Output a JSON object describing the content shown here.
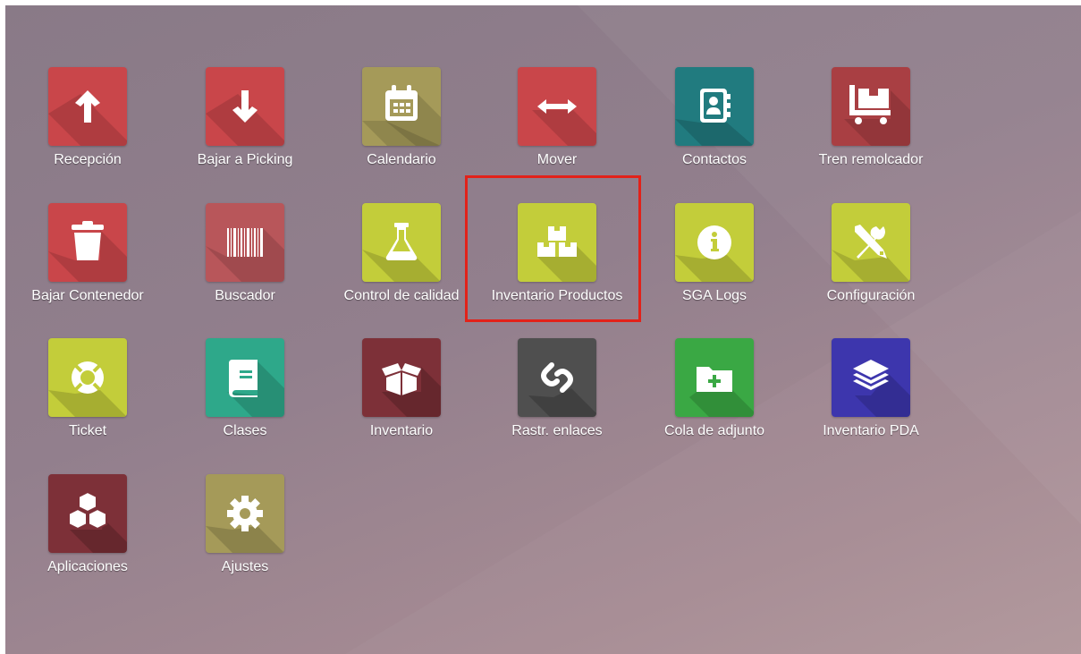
{
  "highlight_color": "#e2221a",
  "apps": [
    {
      "label": "Recepción",
      "icon": "arrow-up-icon",
      "color": "#c9464a"
    },
    {
      "label": "Bajar a Picking",
      "icon": "arrow-down-icon",
      "color": "#c9464a"
    },
    {
      "label": "Calendario",
      "icon": "calendar-icon",
      "color": "#a59a59"
    },
    {
      "label": "Mover",
      "icon": "arrows-horizontal-icon",
      "color": "#c9464a"
    },
    {
      "label": "Contactos",
      "icon": "address-book-icon",
      "color": "#217b7f"
    },
    {
      "label": "Tren remolcador",
      "icon": "dolly-boxes-icon",
      "color": "#a93f43"
    },
    {
      "label": "Bajar Contenedor",
      "icon": "trash-icon",
      "color": "#c9464a"
    },
    {
      "label": "Buscador",
      "icon": "barcode-icon",
      "color": "#b8565a"
    },
    {
      "label": "Control de calidad",
      "icon": "flask-icon",
      "color": "#c3cd3a"
    },
    {
      "label": "Inventario Productos",
      "icon": "cubes-icon",
      "color": "#c3cd3a"
    },
    {
      "label": "SGA Logs",
      "icon": "info-circle-icon",
      "color": "#c3cd3a"
    },
    {
      "label": "Configuración",
      "icon": "wrench-screwdriver-icon",
      "color": "#c3cd3a"
    },
    {
      "label": "Ticket",
      "icon": "life-ring-icon",
      "color": "#c3cd3a"
    },
    {
      "label": "Clases",
      "icon": "book-icon",
      "color": "#2ea88a"
    },
    {
      "label": "Inventario",
      "icon": "open-box-icon",
      "color": "#7d3038"
    },
    {
      "label": "Rastr. enlaces",
      "icon": "link-icon",
      "color": "#4f4f4f"
    },
    {
      "label": "Cola de adjunto",
      "icon": "folder-plus-icon",
      "color": "#3aa844"
    },
    {
      "label": "Inventario PDA",
      "icon": "layers-icon",
      "color": "#3d36ad"
    },
    {
      "label": "Aplicaciones",
      "icon": "cubes-stack-icon",
      "color": "#7d3038"
    },
    {
      "label": "Ajustes",
      "icon": "gear-icon",
      "color": "#a59a59"
    }
  ]
}
